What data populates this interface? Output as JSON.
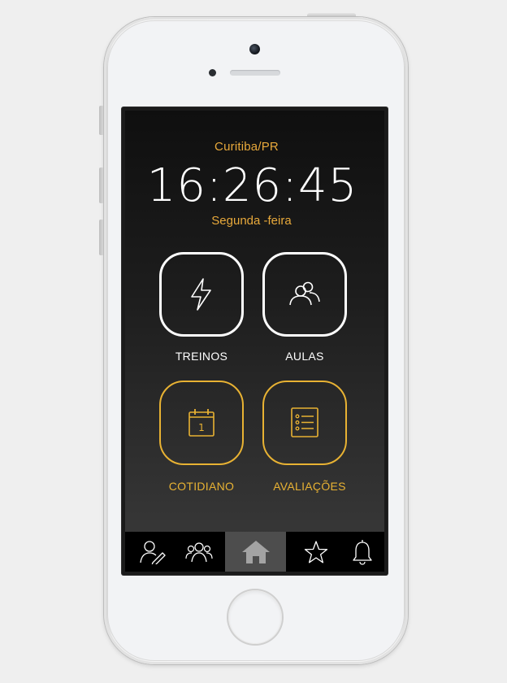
{
  "clock_widget": {
    "city": "Curitiba/PR",
    "time": "16:26:45",
    "weekday": "Segunda -feira"
  },
  "tiles": [
    {
      "id": "treinos",
      "label": "TREINOS",
      "icon": "lightning-icon",
      "color": "#ffffff"
    },
    {
      "id": "aulas",
      "label": "AULAS",
      "icon": "group-icon",
      "color": "#ffffff"
    },
    {
      "id": "cotidiano",
      "label": "COTIDIANO",
      "icon": "calendar-icon",
      "color": "#e8b233",
      "calendar_day": "1"
    },
    {
      "id": "avaliacoes",
      "label": "AVALIAÇÕES",
      "icon": "checklist-icon",
      "color": "#e8b233"
    }
  ],
  "tabbar": {
    "items": [
      {
        "id": "profile",
        "icon": "profile-edit-icon",
        "active": false
      },
      {
        "id": "groups",
        "icon": "group-icon",
        "active": false
      },
      {
        "id": "home",
        "icon": "home-icon",
        "active": true
      },
      {
        "id": "favorites",
        "icon": "star-icon",
        "active": false
      },
      {
        "id": "notifications",
        "icon": "bell-icon",
        "active": false
      }
    ]
  },
  "colors": {
    "accent": "#e8b233",
    "city_text": "#e8a93b",
    "tab_active_bg": "#4d4d4d"
  }
}
